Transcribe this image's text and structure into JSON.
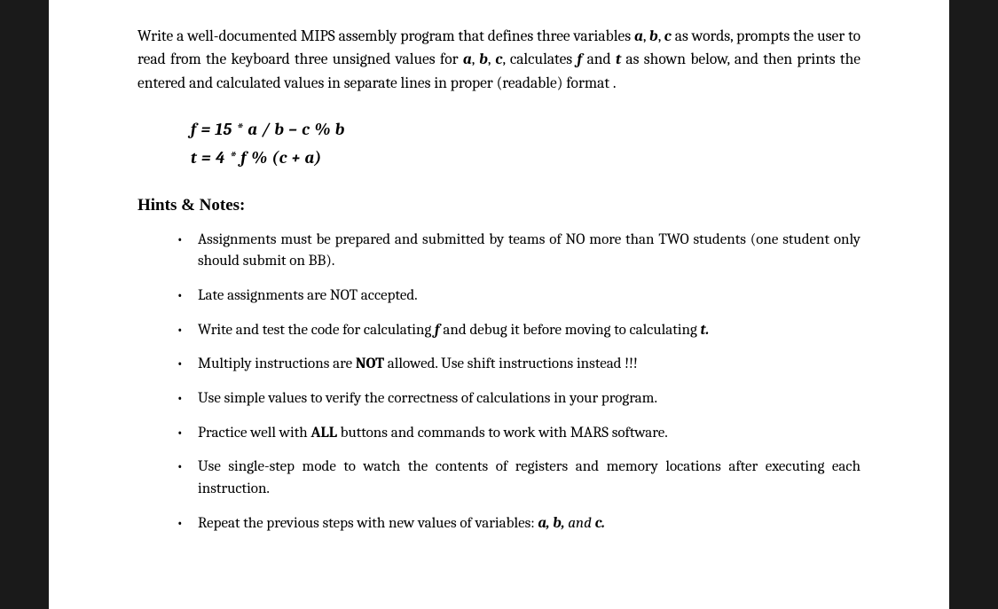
{
  "intro": {
    "part1": "Write a well-documented MIPS assembly program that defines three variables ",
    "a": "a",
    "comma1": ", ",
    "b": "b",
    "comma2": ", ",
    "c": "c",
    "part2": " as words, prompts the user to read from the keyboard three unsigned values for ",
    "a2": "a",
    "comma3": ", ",
    "b2": "b",
    "comma4": ", ",
    "c2": "c",
    "part3": ", calculates ",
    "f": "f",
    "part4": " and ",
    "t": "t",
    "part5": " as shown below, and then prints the entered and calculated values in separate lines in proper (readable) format ."
  },
  "formula1": "f = 15 * a / b – c % b",
  "formula2": "t = 4 * f % (c + a)",
  "section_title": "Hints & Notes:",
  "hints": [
    {
      "text": "Assignments must be prepared and submitted by teams of NO more than TWO students (one student only should submit on BB)."
    },
    {
      "text": "Late assignments are NOT accepted."
    },
    {
      "p1": "Write and test the code for calculating   ",
      "f": "f",
      "p2": " and debug it before moving to calculating  ",
      "t": "t.",
      "p3": ""
    },
    {
      "p1": "Multiply instructions are ",
      "b1": "NOT",
      "p2": " allowed. Use shift instructions instead !!!"
    },
    {
      "text": "Use simple values to verify the correctness of calculations in your program."
    },
    {
      "p1": "Practice well with ",
      "b1": "ALL",
      "p2": " buttons and commands to work with MARS software."
    },
    {
      "text": "Use single-step mode to watch the contents of registers and memory locations after executing each instruction."
    },
    {
      "p1": "Repeat the previous steps with new values of variables:  ",
      "bi1": "a, b,",
      "p2": " ",
      "i1": "and",
      "p3": " ",
      "bi2": "c.",
      "p4": ""
    }
  ]
}
